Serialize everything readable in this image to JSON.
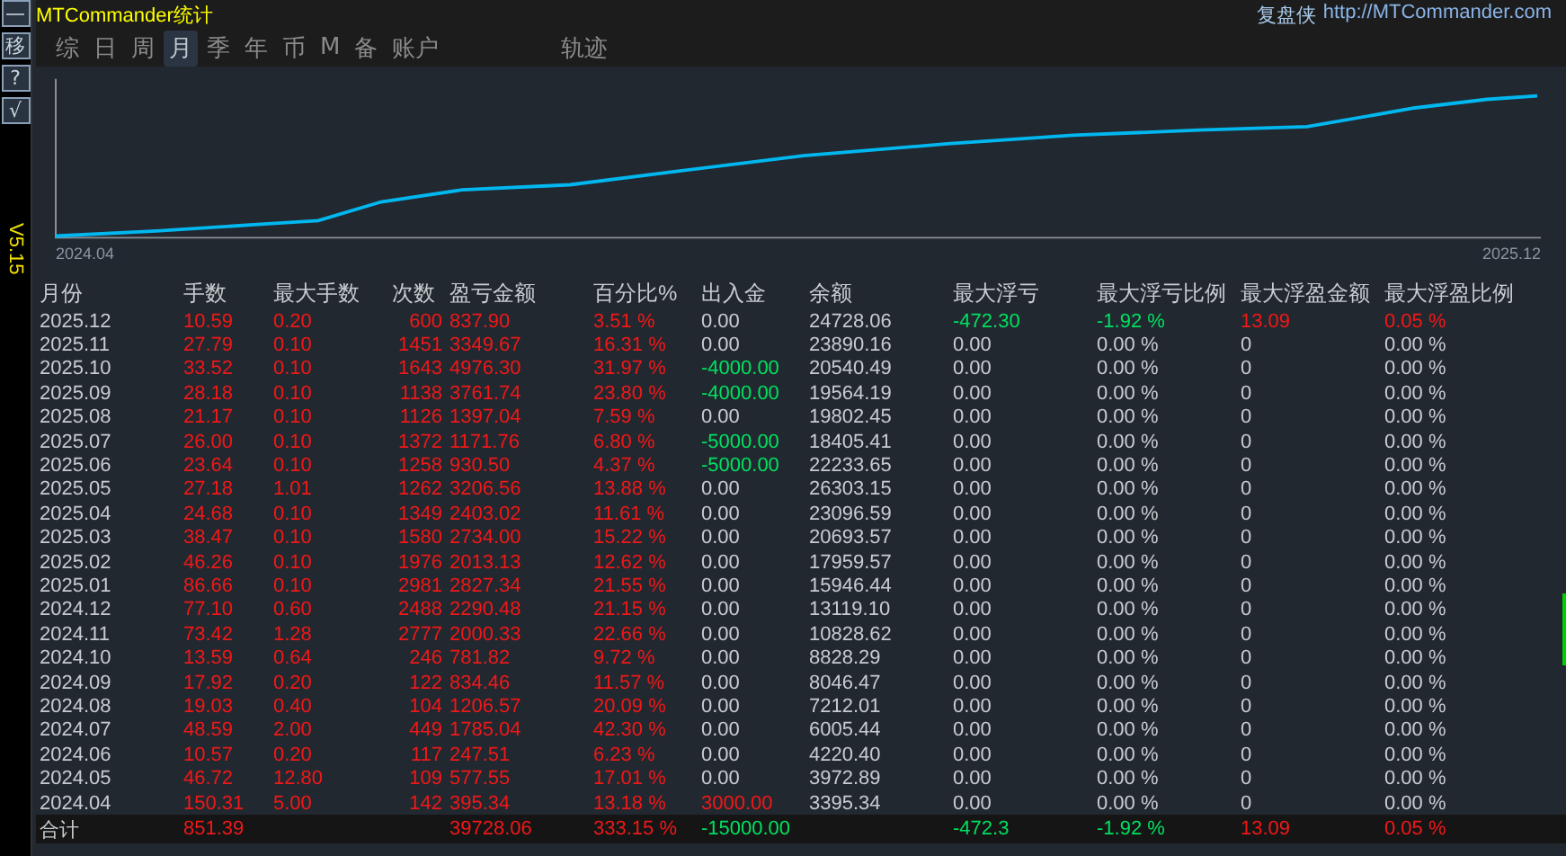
{
  "header": {
    "title": "MTCommander统计",
    "brand": "复盘侠",
    "url": "http://MTCommander.com"
  },
  "sidebar": {
    "buttons": [
      "—",
      "移",
      "?",
      "√"
    ],
    "version": "V5.15"
  },
  "tabs": [
    {
      "label": "综",
      "selected": false
    },
    {
      "label": "日",
      "selected": false
    },
    {
      "label": "周",
      "selected": false
    },
    {
      "label": "月",
      "selected": true
    },
    {
      "label": "季",
      "selected": false
    },
    {
      "label": "年",
      "selected": false
    },
    {
      "label": "币",
      "selected": false
    },
    {
      "label": "M",
      "selected": false
    },
    {
      "label": "备",
      "selected": false
    },
    {
      "label": "账户",
      "selected": false
    },
    {
      "label": "轨迹",
      "selected": false
    }
  ],
  "chart": {
    "x_start": "2024.04",
    "x_end": "2025.12"
  },
  "table": {
    "columns": [
      "月份",
      "手数",
      "最大手数",
      "次数",
      "盈亏金额",
      "百分比%",
      "出入金",
      "余额",
      "最大浮亏",
      "最大浮亏比例",
      "最大浮盈金额",
      "最大浮盈比例"
    ],
    "rows": [
      [
        {
          "text": "2025.12",
          "color": "#c8ccd0"
        },
        {
          "text": "10.59",
          "color": "#f01818"
        },
        {
          "text": "0.20",
          "color": "#f01818"
        },
        {
          "text": "600",
          "color": "#f01818"
        },
        {
          "text": "837.90",
          "color": "#f01818"
        },
        {
          "text": "3.51 %",
          "color": "#f01818"
        },
        {
          "text": "0.00",
          "color": "#c8ccd0"
        },
        {
          "text": "24728.06",
          "color": "#c8ccd0"
        },
        {
          "text": "-472.30",
          "color": "#00e060"
        },
        {
          "text": "-1.92 %",
          "color": "#00e060"
        },
        {
          "text": "13.09",
          "color": "#f01818"
        },
        {
          "text": "0.05 %",
          "color": "#f01818"
        }
      ],
      [
        {
          "text": "2025.11",
          "color": "#c8ccd0"
        },
        {
          "text": "27.79",
          "color": "#f01818"
        },
        {
          "text": "0.10",
          "color": "#f01818"
        },
        {
          "text": "1451",
          "color": "#f01818"
        },
        {
          "text": "3349.67",
          "color": "#f01818"
        },
        {
          "text": "16.31 %",
          "color": "#f01818"
        },
        {
          "text": "0.00",
          "color": "#c8ccd0"
        },
        {
          "text": "23890.16",
          "color": "#c8ccd0"
        },
        {
          "text": "0.00",
          "color": "#c8ccd0"
        },
        {
          "text": "0.00 %",
          "color": "#c8ccd0"
        },
        {
          "text": "0",
          "color": "#c8ccd0"
        },
        {
          "text": "0.00 %",
          "color": "#c8ccd0"
        }
      ],
      [
        {
          "text": "2025.10",
          "color": "#c8ccd0"
        },
        {
          "text": "33.52",
          "color": "#f01818"
        },
        {
          "text": "0.10",
          "color": "#f01818"
        },
        {
          "text": "1643",
          "color": "#f01818"
        },
        {
          "text": "4976.30",
          "color": "#f01818"
        },
        {
          "text": "31.97 %",
          "color": "#f01818"
        },
        {
          "text": "-4000.00",
          "color": "#00e060"
        },
        {
          "text": "20540.49",
          "color": "#c8ccd0"
        },
        {
          "text": "0.00",
          "color": "#c8ccd0"
        },
        {
          "text": "0.00 %",
          "color": "#c8ccd0"
        },
        {
          "text": "0",
          "color": "#c8ccd0"
        },
        {
          "text": "0.00 %",
          "color": "#c8ccd0"
        }
      ],
      [
        {
          "text": "2025.09",
          "color": "#c8ccd0"
        },
        {
          "text": "28.18",
          "color": "#f01818"
        },
        {
          "text": "0.10",
          "color": "#f01818"
        },
        {
          "text": "1138",
          "color": "#f01818"
        },
        {
          "text": "3761.74",
          "color": "#f01818"
        },
        {
          "text": "23.80 %",
          "color": "#f01818"
        },
        {
          "text": "-4000.00",
          "color": "#00e060"
        },
        {
          "text": "19564.19",
          "color": "#c8ccd0"
        },
        {
          "text": "0.00",
          "color": "#c8ccd0"
        },
        {
          "text": "0.00 %",
          "color": "#c8ccd0"
        },
        {
          "text": "0",
          "color": "#c8ccd0"
        },
        {
          "text": "0.00 %",
          "color": "#c8ccd0"
        }
      ],
      [
        {
          "text": "2025.08",
          "color": "#c8ccd0"
        },
        {
          "text": "21.17",
          "color": "#f01818"
        },
        {
          "text": "0.10",
          "color": "#f01818"
        },
        {
          "text": "1126",
          "color": "#f01818"
        },
        {
          "text": "1397.04",
          "color": "#f01818"
        },
        {
          "text": "7.59 %",
          "color": "#f01818"
        },
        {
          "text": "0.00",
          "color": "#c8ccd0"
        },
        {
          "text": "19802.45",
          "color": "#c8ccd0"
        },
        {
          "text": "0.00",
          "color": "#c8ccd0"
        },
        {
          "text": "0.00 %",
          "color": "#c8ccd0"
        },
        {
          "text": "0",
          "color": "#c8ccd0"
        },
        {
          "text": "0.00 %",
          "color": "#c8ccd0"
        }
      ],
      [
        {
          "text": "2025.07",
          "color": "#c8ccd0"
        },
        {
          "text": "26.00",
          "color": "#f01818"
        },
        {
          "text": "0.10",
          "color": "#f01818"
        },
        {
          "text": "1372",
          "color": "#f01818"
        },
        {
          "text": "1171.76",
          "color": "#f01818"
        },
        {
          "text": "6.80 %",
          "color": "#f01818"
        },
        {
          "text": "-5000.00",
          "color": "#00e060"
        },
        {
          "text": "18405.41",
          "color": "#c8ccd0"
        },
        {
          "text": "0.00",
          "color": "#c8ccd0"
        },
        {
          "text": "0.00 %",
          "color": "#c8ccd0"
        },
        {
          "text": "0",
          "color": "#c8ccd0"
        },
        {
          "text": "0.00 %",
          "color": "#c8ccd0"
        }
      ],
      [
        {
          "text": "2025.06",
          "color": "#c8ccd0"
        },
        {
          "text": "23.64",
          "color": "#f01818"
        },
        {
          "text": "0.10",
          "color": "#f01818"
        },
        {
          "text": "1258",
          "color": "#f01818"
        },
        {
          "text": "930.50",
          "color": "#f01818"
        },
        {
          "text": "4.37 %",
          "color": "#f01818"
        },
        {
          "text": "-5000.00",
          "color": "#00e060"
        },
        {
          "text": "22233.65",
          "color": "#c8ccd0"
        },
        {
          "text": "0.00",
          "color": "#c8ccd0"
        },
        {
          "text": "0.00 %",
          "color": "#c8ccd0"
        },
        {
          "text": "0",
          "color": "#c8ccd0"
        },
        {
          "text": "0.00 %",
          "color": "#c8ccd0"
        }
      ],
      [
        {
          "text": "2025.05",
          "color": "#c8ccd0"
        },
        {
          "text": "27.18",
          "color": "#f01818"
        },
        {
          "text": "1.01",
          "color": "#f01818"
        },
        {
          "text": "1262",
          "color": "#f01818"
        },
        {
          "text": "3206.56",
          "color": "#f01818"
        },
        {
          "text": "13.88 %",
          "color": "#f01818"
        },
        {
          "text": "0.00",
          "color": "#c8ccd0"
        },
        {
          "text": "26303.15",
          "color": "#c8ccd0"
        },
        {
          "text": "0.00",
          "color": "#c8ccd0"
        },
        {
          "text": "0.00 %",
          "color": "#c8ccd0"
        },
        {
          "text": "0",
          "color": "#c8ccd0"
        },
        {
          "text": "0.00 %",
          "color": "#c8ccd0"
        }
      ],
      [
        {
          "text": "2025.04",
          "color": "#c8ccd0"
        },
        {
          "text": "24.68",
          "color": "#f01818"
        },
        {
          "text": "0.10",
          "color": "#f01818"
        },
        {
          "text": "1349",
          "color": "#f01818"
        },
        {
          "text": "2403.02",
          "color": "#f01818"
        },
        {
          "text": "11.61 %",
          "color": "#f01818"
        },
        {
          "text": "0.00",
          "color": "#c8ccd0"
        },
        {
          "text": "23096.59",
          "color": "#c8ccd0"
        },
        {
          "text": "0.00",
          "color": "#c8ccd0"
        },
        {
          "text": "0.00 %",
          "color": "#c8ccd0"
        },
        {
          "text": "0",
          "color": "#c8ccd0"
        },
        {
          "text": "0.00 %",
          "color": "#c8ccd0"
        }
      ],
      [
        {
          "text": "2025.03",
          "color": "#c8ccd0"
        },
        {
          "text": "38.47",
          "color": "#f01818"
        },
        {
          "text": "0.10",
          "color": "#f01818"
        },
        {
          "text": "1580",
          "color": "#f01818"
        },
        {
          "text": "2734.00",
          "color": "#f01818"
        },
        {
          "text": "15.22 %",
          "color": "#f01818"
        },
        {
          "text": "0.00",
          "color": "#c8ccd0"
        },
        {
          "text": "20693.57",
          "color": "#c8ccd0"
        },
        {
          "text": "0.00",
          "color": "#c8ccd0"
        },
        {
          "text": "0.00 %",
          "color": "#c8ccd0"
        },
        {
          "text": "0",
          "color": "#c8ccd0"
        },
        {
          "text": "0.00 %",
          "color": "#c8ccd0"
        }
      ],
      [
        {
          "text": "2025.02",
          "color": "#c8ccd0"
        },
        {
          "text": "46.26",
          "color": "#f01818"
        },
        {
          "text": "0.10",
          "color": "#f01818"
        },
        {
          "text": "1976",
          "color": "#f01818"
        },
        {
          "text": "2013.13",
          "color": "#f01818"
        },
        {
          "text": "12.62 %",
          "color": "#f01818"
        },
        {
          "text": "0.00",
          "color": "#c8ccd0"
        },
        {
          "text": "17959.57",
          "color": "#c8ccd0"
        },
        {
          "text": "0.00",
          "color": "#c8ccd0"
        },
        {
          "text": "0.00 %",
          "color": "#c8ccd0"
        },
        {
          "text": "0",
          "color": "#c8ccd0"
        },
        {
          "text": "0.00 %",
          "color": "#c8ccd0"
        }
      ],
      [
        {
          "text": "2025.01",
          "color": "#c8ccd0"
        },
        {
          "text": "86.66",
          "color": "#f01818"
        },
        {
          "text": "0.10",
          "color": "#f01818"
        },
        {
          "text": "2981",
          "color": "#f01818"
        },
        {
          "text": "2827.34",
          "color": "#f01818"
        },
        {
          "text": "21.55 %",
          "color": "#f01818"
        },
        {
          "text": "0.00",
          "color": "#c8ccd0"
        },
        {
          "text": "15946.44",
          "color": "#c8ccd0"
        },
        {
          "text": "0.00",
          "color": "#c8ccd0"
        },
        {
          "text": "0.00 %",
          "color": "#c8ccd0"
        },
        {
          "text": "0",
          "color": "#c8ccd0"
        },
        {
          "text": "0.00 %",
          "color": "#c8ccd0"
        }
      ],
      [
        {
          "text": "2024.12",
          "color": "#c8ccd0"
        },
        {
          "text": "77.10",
          "color": "#f01818"
        },
        {
          "text": "0.60",
          "color": "#f01818"
        },
        {
          "text": "2488",
          "color": "#f01818"
        },
        {
          "text": "2290.48",
          "color": "#f01818"
        },
        {
          "text": "21.15 %",
          "color": "#f01818"
        },
        {
          "text": "0.00",
          "color": "#c8ccd0"
        },
        {
          "text": "13119.10",
          "color": "#c8ccd0"
        },
        {
          "text": "0.00",
          "color": "#c8ccd0"
        },
        {
          "text": "0.00 %",
          "color": "#c8ccd0"
        },
        {
          "text": "0",
          "color": "#c8ccd0"
        },
        {
          "text": "0.00 %",
          "color": "#c8ccd0"
        }
      ],
      [
        {
          "text": "2024.11",
          "color": "#c8ccd0"
        },
        {
          "text": "73.42",
          "color": "#f01818"
        },
        {
          "text": "1.28",
          "color": "#f01818"
        },
        {
          "text": "2777",
          "color": "#f01818"
        },
        {
          "text": "2000.33",
          "color": "#f01818"
        },
        {
          "text": "22.66 %",
          "color": "#f01818"
        },
        {
          "text": "0.00",
          "color": "#c8ccd0"
        },
        {
          "text": "10828.62",
          "color": "#c8ccd0"
        },
        {
          "text": "0.00",
          "color": "#c8ccd0"
        },
        {
          "text": "0.00 %",
          "color": "#c8ccd0"
        },
        {
          "text": "0",
          "color": "#c8ccd0"
        },
        {
          "text": "0.00 %",
          "color": "#c8ccd0"
        }
      ],
      [
        {
          "text": "2024.10",
          "color": "#c8ccd0"
        },
        {
          "text": "13.59",
          "color": "#f01818"
        },
        {
          "text": "0.64",
          "color": "#f01818"
        },
        {
          "text": "246",
          "color": "#f01818"
        },
        {
          "text": "781.82",
          "color": "#f01818"
        },
        {
          "text": "9.72 %",
          "color": "#f01818"
        },
        {
          "text": "0.00",
          "color": "#c8ccd0"
        },
        {
          "text": "8828.29",
          "color": "#c8ccd0"
        },
        {
          "text": "0.00",
          "color": "#c8ccd0"
        },
        {
          "text": "0.00 %",
          "color": "#c8ccd0"
        },
        {
          "text": "0",
          "color": "#c8ccd0"
        },
        {
          "text": "0.00 %",
          "color": "#c8ccd0"
        }
      ],
      [
        {
          "text": "2024.09",
          "color": "#c8ccd0"
        },
        {
          "text": "17.92",
          "color": "#f01818"
        },
        {
          "text": "0.20",
          "color": "#f01818"
        },
        {
          "text": "122",
          "color": "#f01818"
        },
        {
          "text": "834.46",
          "color": "#f01818"
        },
        {
          "text": "11.57 %",
          "color": "#f01818"
        },
        {
          "text": "0.00",
          "color": "#c8ccd0"
        },
        {
          "text": "8046.47",
          "color": "#c8ccd0"
        },
        {
          "text": "0.00",
          "color": "#c8ccd0"
        },
        {
          "text": "0.00 %",
          "color": "#c8ccd0"
        },
        {
          "text": "0",
          "color": "#c8ccd0"
        },
        {
          "text": "0.00 %",
          "color": "#c8ccd0"
        }
      ],
      [
        {
          "text": "2024.08",
          "color": "#c8ccd0"
        },
        {
          "text": "19.03",
          "color": "#f01818"
        },
        {
          "text": "0.40",
          "color": "#f01818"
        },
        {
          "text": "104",
          "color": "#f01818"
        },
        {
          "text": "1206.57",
          "color": "#f01818"
        },
        {
          "text": "20.09 %",
          "color": "#f01818"
        },
        {
          "text": "0.00",
          "color": "#c8ccd0"
        },
        {
          "text": "7212.01",
          "color": "#c8ccd0"
        },
        {
          "text": "0.00",
          "color": "#c8ccd0"
        },
        {
          "text": "0.00 %",
          "color": "#c8ccd0"
        },
        {
          "text": "0",
          "color": "#c8ccd0"
        },
        {
          "text": "0.00 %",
          "color": "#c8ccd0"
        }
      ],
      [
        {
          "text": "2024.07",
          "color": "#c8ccd0"
        },
        {
          "text": "48.59",
          "color": "#f01818"
        },
        {
          "text": "2.00",
          "color": "#f01818"
        },
        {
          "text": "449",
          "color": "#f01818"
        },
        {
          "text": "1785.04",
          "color": "#f01818"
        },
        {
          "text": "42.30 %",
          "color": "#f01818"
        },
        {
          "text": "0.00",
          "color": "#c8ccd0"
        },
        {
          "text": "6005.44",
          "color": "#c8ccd0"
        },
        {
          "text": "0.00",
          "color": "#c8ccd0"
        },
        {
          "text": "0.00 %",
          "color": "#c8ccd0"
        },
        {
          "text": "0",
          "color": "#c8ccd0"
        },
        {
          "text": "0.00 %",
          "color": "#c8ccd0"
        }
      ],
      [
        {
          "text": "2024.06",
          "color": "#c8ccd0"
        },
        {
          "text": "10.57",
          "color": "#f01818"
        },
        {
          "text": "0.20",
          "color": "#f01818"
        },
        {
          "text": "117",
          "color": "#f01818"
        },
        {
          "text": "247.51",
          "color": "#f01818"
        },
        {
          "text": "6.23 %",
          "color": "#f01818"
        },
        {
          "text": "0.00",
          "color": "#c8ccd0"
        },
        {
          "text": "4220.40",
          "color": "#c8ccd0"
        },
        {
          "text": "0.00",
          "color": "#c8ccd0"
        },
        {
          "text": "0.00 %",
          "color": "#c8ccd0"
        },
        {
          "text": "0",
          "color": "#c8ccd0"
        },
        {
          "text": "0.00 %",
          "color": "#c8ccd0"
        }
      ],
      [
        {
          "text": "2024.05",
          "color": "#c8ccd0"
        },
        {
          "text": "46.72",
          "color": "#f01818"
        },
        {
          "text": "12.80",
          "color": "#f01818"
        },
        {
          "text": "109",
          "color": "#f01818"
        },
        {
          "text": "577.55",
          "color": "#f01818"
        },
        {
          "text": "17.01 %",
          "color": "#f01818"
        },
        {
          "text": "0.00",
          "color": "#c8ccd0"
        },
        {
          "text": "3972.89",
          "color": "#c8ccd0"
        },
        {
          "text": "0.00",
          "color": "#c8ccd0"
        },
        {
          "text": "0.00 %",
          "color": "#c8ccd0"
        },
        {
          "text": "0",
          "color": "#c8ccd0"
        },
        {
          "text": "0.00 %",
          "color": "#c8ccd0"
        }
      ],
      [
        {
          "text": "2024.04",
          "color": "#c8ccd0"
        },
        {
          "text": "150.31",
          "color": "#f01818"
        },
        {
          "text": "5.00",
          "color": "#f01818"
        },
        {
          "text": "142",
          "color": "#f01818"
        },
        {
          "text": "395.34",
          "color": "#f01818"
        },
        {
          "text": "13.18 %",
          "color": "#f01818"
        },
        {
          "text": "3000.00",
          "color": "#f01818"
        },
        {
          "text": "3395.34",
          "color": "#c8ccd0"
        },
        {
          "text": "0.00",
          "color": "#c8ccd0"
        },
        {
          "text": "0.00 %",
          "color": "#c8ccd0"
        },
        {
          "text": "0",
          "color": "#c8ccd0"
        },
        {
          "text": "0.00 %",
          "color": "#c8ccd0"
        }
      ]
    ],
    "total": {
      "label": {
        "text": "合计",
        "color": "#c8ccd0"
      },
      "lots": {
        "text": "851.39",
        "color": "#f01818"
      },
      "profit": {
        "text": "39728.06",
        "color": "#f01818"
      },
      "percent": {
        "text": "333.15 %",
        "color": "#f01818"
      },
      "deposit": {
        "text": "-15000.00",
        "color": "#00e060"
      },
      "max_float_loss": {
        "text": "-472.3",
        "color": "#00e060"
      },
      "max_float_loss_pct": {
        "text": "-1.92 %",
        "color": "#00e060"
      },
      "max_float_profit": {
        "text": "13.09",
        "color": "#f01818"
      },
      "max_float_profit_pct": {
        "text": "0.05 %",
        "color": "#f01818"
      }
    }
  }
}
